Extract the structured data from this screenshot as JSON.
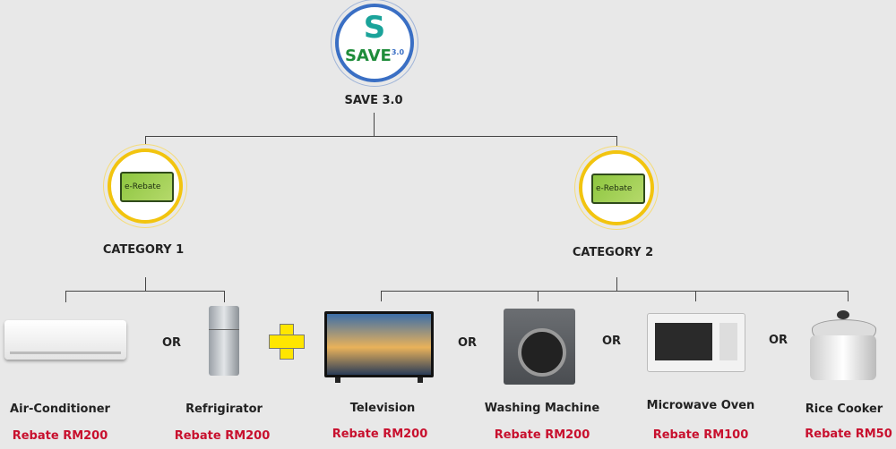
{
  "root": {
    "title": "SAVE 3.0",
    "logo_text": "SAVE",
    "logo_version": "3.0"
  },
  "categories": [
    {
      "title": "CATEGORY 1",
      "icon_text": "e-Rebate"
    },
    {
      "title": "CATEGORY 2",
      "icon_text": "e-Rebate"
    }
  ],
  "or_label": "OR",
  "products": [
    {
      "name": "Air-Conditioner",
      "rebate": "Rebate RM200"
    },
    {
      "name": "Refrigirator",
      "rebate": "Rebate RM200"
    },
    {
      "name": "Television",
      "rebate": "Rebate RM200"
    },
    {
      "name": "Washing Machine",
      "rebate": "Rebate RM200"
    },
    {
      "name": "Microwave Oven",
      "rebate": "Rebate RM100"
    },
    {
      "name": "Rice Cooker",
      "rebate": "Rebate RM50"
    }
  ],
  "colors": {
    "rebate": "#c8102e",
    "badge_ring": "#f2c40f",
    "logo_ring": "#3a6fc4",
    "plus": "#ffe600"
  }
}
